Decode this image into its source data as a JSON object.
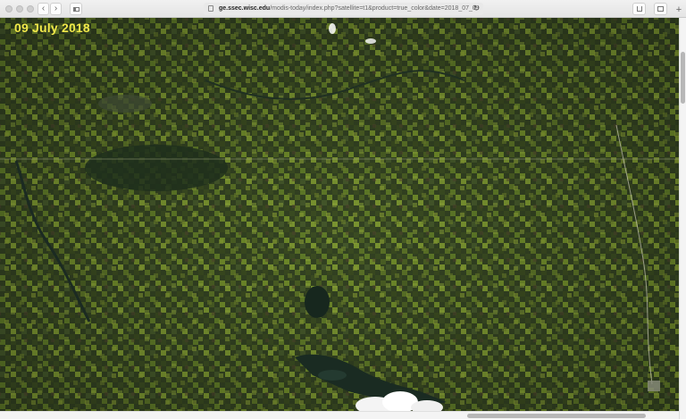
{
  "browser": {
    "url_domain": "ge.ssec.wisc.edu",
    "url_path": "/modis-today/index.php?satellite=t1&product=true_color&date=2018_07_09",
    "reload_icon": "reload-icon",
    "back_icon": "chevron-left-icon",
    "forward_icon": "chevron-right-icon",
    "sidebar_icon": "sidebar-icon",
    "share_icon": "share-icon",
    "tabs_icon": "tabs-icon",
    "new_tab_icon": "plus-icon"
  },
  "image": {
    "date_label": "09 July 2018",
    "date_color": "#f0e84a",
    "land_color": "#2f3b20",
    "field_color": "#6f8a2a",
    "water_color": "#1f2f25",
    "cloud_color": "#ffffff"
  }
}
